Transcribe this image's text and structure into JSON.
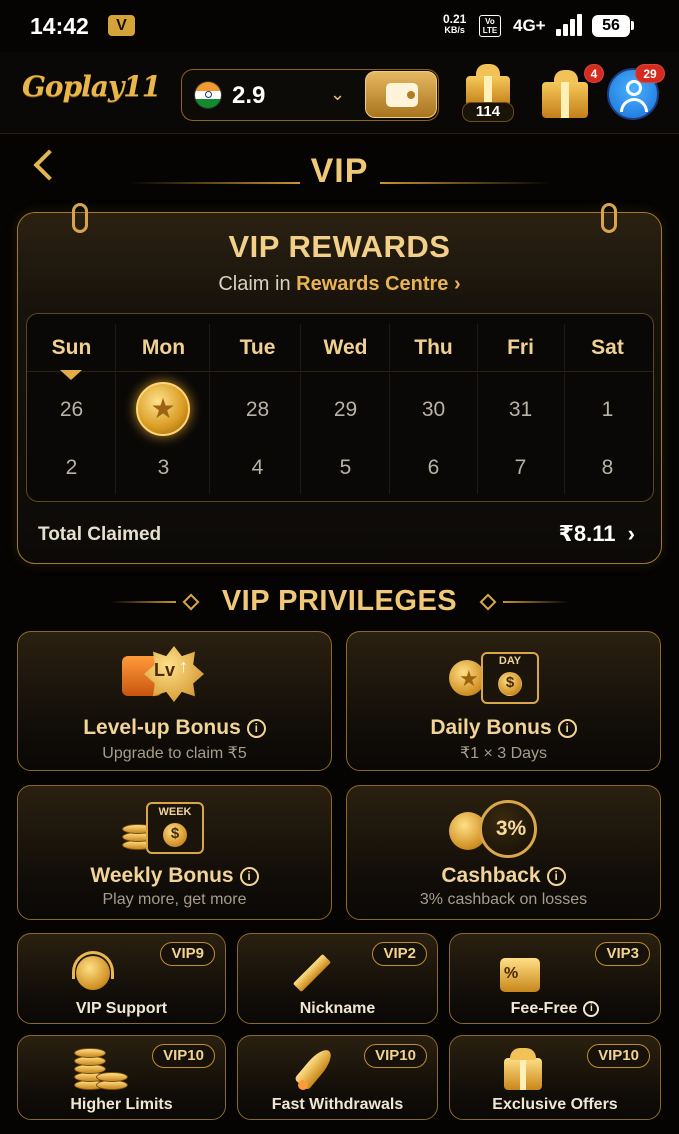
{
  "status_bar": {
    "time": "14:42",
    "v_icon": "V",
    "speed_top": "0.21",
    "speed_unit": "KB/s",
    "volte_top": "Vo",
    "volte_bottom": "LTE",
    "network": "4G+",
    "battery": "56"
  },
  "app_bar": {
    "logo": "Goplay11",
    "balance": "2.9",
    "flag_icon": "india-flag-icon",
    "chevron_icon": "chevron-down-icon",
    "wallet_icon": "wallet-icon",
    "gift_count": "114",
    "notification_badge": "4",
    "profile_badge": "29"
  },
  "page": {
    "title": "VIP"
  },
  "rewards": {
    "title": "VIP REWARDS",
    "subtitle_prefix": "Claim in",
    "subtitle_link": "Rewards Centre",
    "calendar": {
      "days": [
        "Sun",
        "Mon",
        "Tue",
        "Wed",
        "Thu",
        "Fri",
        "Sat"
      ],
      "week1": [
        "26",
        "",
        "28",
        "29",
        "30",
        "31",
        "1"
      ],
      "week2": [
        "2",
        "3",
        "4",
        "5",
        "6",
        "7",
        "8"
      ],
      "claimed_day_icon": "gold-star-coin-icon",
      "today_marker": "Sun"
    },
    "total_label": "Total Claimed",
    "total_amount": "₹8.11"
  },
  "privileges": {
    "title": "VIP PRIVILEGES",
    "big": [
      {
        "title": "Level-up Bonus",
        "sub": "Upgrade to claim ₹5",
        "icon": "level-up-icon",
        "icon_text": "Lv"
      },
      {
        "title": "Daily Bonus",
        "sub": "₹1 × 3 Days",
        "icon": "daily-calendar-icon",
        "icon_text": "DAY"
      },
      {
        "title": "Weekly Bonus",
        "sub": "Play more, get more",
        "icon": "weekly-calendar-icon",
        "icon_text": "WEEK"
      },
      {
        "title": "Cashback",
        "sub": "3% cashback on losses",
        "icon": "cashback-icon",
        "icon_text": "3%"
      }
    ],
    "small": [
      {
        "title": "VIP Support",
        "badge": "VIP9",
        "icon": "headset-icon"
      },
      {
        "title": "Nickname",
        "badge": "VIP2",
        "icon": "pencil-icon"
      },
      {
        "title": "Fee-Free",
        "badge": "VIP3",
        "icon": "fee-free-wallet-icon"
      },
      {
        "title": "Higher Limits",
        "badge": "VIP10",
        "icon": "coin-stack-icon"
      },
      {
        "title": "Fast Withdrawals",
        "badge": "VIP10",
        "icon": "rocket-icon"
      },
      {
        "title": "Exclusive Offers",
        "badge": "VIP10",
        "icon": "gift-icon"
      }
    ]
  },
  "colors": {
    "gold": "#e9b454",
    "background": "#050403",
    "card_border": "#8a6a28"
  }
}
